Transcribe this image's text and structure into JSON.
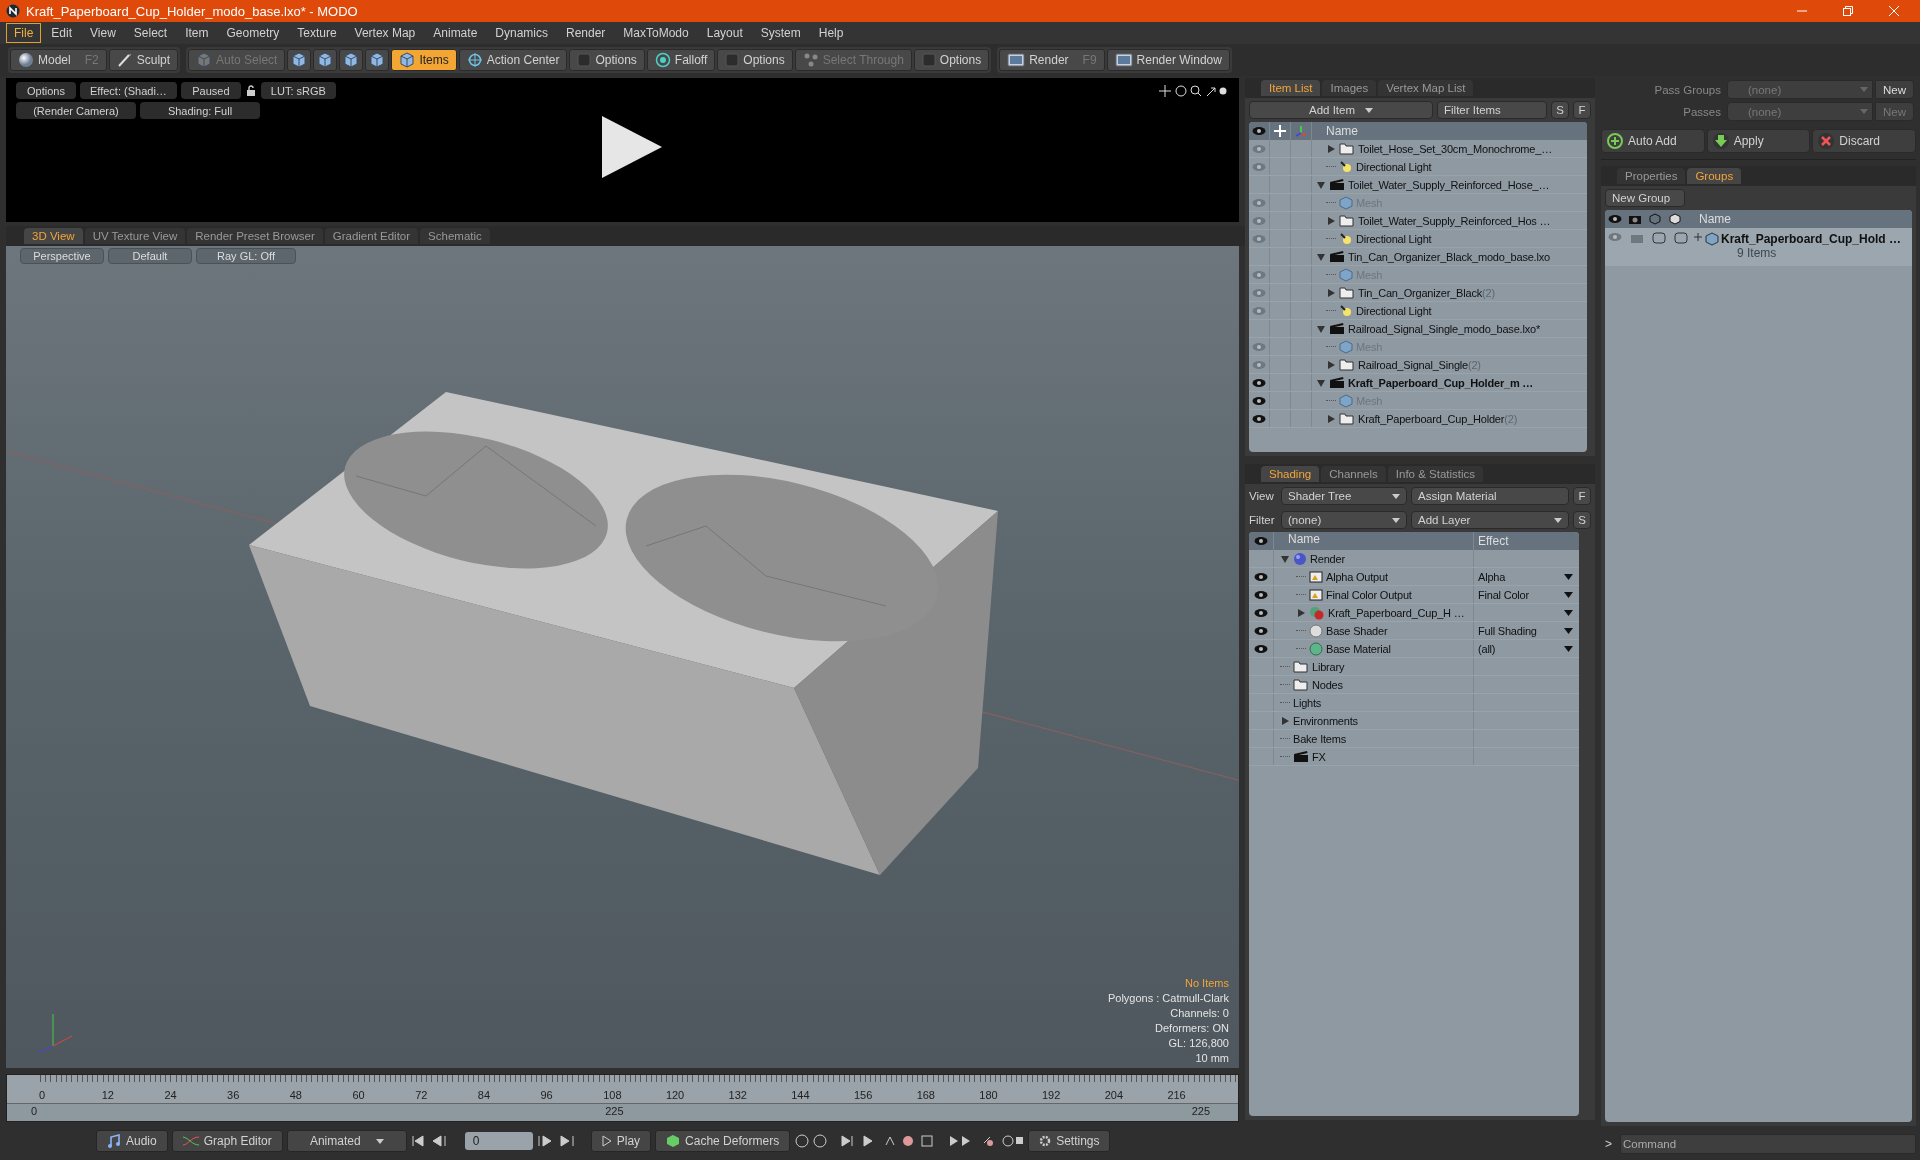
{
  "window": {
    "title": "Kraft_Paperboard_Cup_Holder_modo_base.lxo* - MODO"
  },
  "menu": [
    {
      "label": "File",
      "selected": true
    },
    {
      "label": "Edit",
      "selected": false
    },
    {
      "label": "View",
      "selected": false
    },
    {
      "label": "Select",
      "selected": false
    },
    {
      "label": "Item",
      "selected": false
    },
    {
      "label": "Geometry",
      "selected": false
    },
    {
      "label": "Texture",
      "selected": false
    },
    {
      "label": "Vertex Map",
      "selected": false
    },
    {
      "label": "Animate",
      "selected": false
    },
    {
      "label": "Dynamics",
      "selected": false
    },
    {
      "label": "Render",
      "selected": false
    },
    {
      "label": "MaxToModo",
      "selected": false
    },
    {
      "label": "Layout",
      "selected": false
    },
    {
      "label": "System",
      "selected": false
    },
    {
      "label": "Help",
      "selected": false
    }
  ],
  "toolbar": [
    [
      {
        "kind": "model",
        "label": "Model",
        "shortcut": "F2",
        "selected": false,
        "disabled": false
      },
      {
        "kind": "sculpt",
        "label": "Sculpt",
        "selected": false,
        "disabled": false
      }
    ],
    [
      {
        "kind": "autoselect",
        "label": "Auto Select",
        "selected": false,
        "disabled": true
      },
      {
        "kind": "vertex",
        "selected": false,
        "disabled": false
      },
      {
        "kind": "edge",
        "selected": false,
        "disabled": false
      },
      {
        "kind": "polygon",
        "selected": false,
        "disabled": false
      },
      {
        "kind": "material",
        "selected": false,
        "disabled": false
      },
      {
        "kind": "items",
        "label": "Items",
        "selected": true,
        "disabled": false
      },
      {
        "kind": "center",
        "label": "Action Center",
        "selected": false,
        "disabled": false
      },
      {
        "kind": "check",
        "label": "Options",
        "selected": false,
        "disabled": false
      },
      {
        "kind": "falloff",
        "label": "Falloff",
        "selected": false,
        "disabled": false
      },
      {
        "kind": "check",
        "label": "Options",
        "selected": false,
        "disabled": false
      },
      {
        "kind": "through",
        "label": "Select Through",
        "selected": false,
        "disabled": true
      },
      {
        "kind": "check",
        "label": "Options",
        "selected": false,
        "disabled": false
      }
    ],
    [
      {
        "kind": "render",
        "label": "Render",
        "shortcut": "F9",
        "selected": false,
        "disabled": false
      },
      {
        "kind": "window",
        "label": "Render Window",
        "selected": false,
        "disabled": false
      }
    ]
  ],
  "preview": {
    "buttons": [
      "Options",
      "Effect: (Shadi…",
      "Paused"
    ],
    "lut": "LUT: sRGB",
    "row2": [
      "(Render Camera)",
      "Shading: Full"
    ]
  },
  "viewport": {
    "tabs": [
      {
        "label": "3D View",
        "selected": true
      },
      {
        "label": "UV Texture View",
        "selected": false
      },
      {
        "label": "Render Preset Browser",
        "selected": false
      },
      {
        "label": "Gradient Editor",
        "selected": false
      },
      {
        "label": "Schematic",
        "selected": false
      }
    ],
    "header": [
      "Perspective",
      "Default",
      "Ray GL: Off"
    ],
    "selection": "No Items",
    "info": [
      "Polygons : Catmull-Clark",
      "Channels: 0",
      "Deformers: ON",
      "GL: 126,800",
      "10 mm"
    ]
  },
  "timeline": {
    "ticks": [
      "0",
      "12",
      "24",
      "36",
      "48",
      "60",
      "72",
      "84",
      "96",
      "108",
      "120",
      "132",
      "144",
      "156",
      "168",
      "180",
      "192",
      "204",
      "216"
    ],
    "start": "0",
    "middle": "225",
    "end": "225"
  },
  "transport": {
    "audio": "Audio",
    "graph": "Graph Editor",
    "mode": "Animated",
    "frame": "0",
    "play": "Play",
    "cache": "Cache Deformers",
    "settings": "Settings"
  },
  "item_list": {
    "tabs": [
      {
        "label": "Item List",
        "selected": true
      },
      {
        "label": "Images",
        "selected": false
      },
      {
        "label": "Vertex Map List",
        "selected": false
      }
    ],
    "add_item": "Add Item",
    "filter": "Filter Items",
    "toggles": [
      "S",
      "F"
    ],
    "column": "Name",
    "rows": [
      {
        "children": [
          {
            "label": "Toilet_Hose_Set_30cm_Monochrome_…",
            "kind": "group",
            "visible": false,
            "expanded": false
          },
          {
            "label": "Directional Light",
            "kind": "light",
            "visible": false
          }
        ]
      },
      {
        "label": "Toilet_Water_Supply_Reinforced_Hose_…",
        "kind": "scene",
        "current": false,
        "expanded": true,
        "children": [
          {
            "label": "Mesh",
            "kind": "mesh",
            "visible": false
          },
          {
            "label": "Toilet_Water_Supply_Reinforced_Hos …",
            "kind": "group",
            "visible": false,
            "expanded": false
          },
          {
            "label": "Directional Light",
            "kind": "light",
            "visible": false
          }
        ]
      },
      {
        "label": "Tin_Can_Organizer_Black_modo_base.lxo",
        "kind": "scene",
        "current": false,
        "expanded": true,
        "children": [
          {
            "label": "Mesh",
            "kind": "mesh",
            "visible": false
          },
          {
            "label": "Tin_Can_Organizer_Black",
            "count": "(2)",
            "kind": "group",
            "visible": false,
            "expanded": false
          },
          {
            "label": "Directional Light",
            "kind": "light",
            "visible": false
          }
        ]
      },
      {
        "label": "Railroad_Signal_Single_modo_base.lxo*",
        "kind": "scene",
        "current": false,
        "expanded": true,
        "children": [
          {
            "label": "Mesh",
            "kind": "mesh",
            "visible": false
          },
          {
            "label": "Railroad_Signal_Single",
            "count": "(2)",
            "kind": "group",
            "visible": false,
            "expanded": false
          }
        ]
      },
      {
        "label": "Kraft_Paperboard_Cup_Holder_m …",
        "kind": "scene",
        "current": true,
        "visible": true,
        "expanded": true,
        "children": [
          {
            "label": "Mesh",
            "kind": "mesh",
            "visible": true
          },
          {
            "label": "Kraft_Paperboard_Cup_Holder",
            "count": "(2)",
            "kind": "group",
            "visible": true,
            "expanded": false
          }
        ]
      }
    ]
  },
  "shading": {
    "tabs": [
      {
        "label": "Shading",
        "selected": true
      },
      {
        "label": "Channels",
        "selected": false
      },
      {
        "label": "Info & Statistics",
        "selected": false
      }
    ],
    "view_label": "View",
    "view": "Shader Tree",
    "assign": "Assign Material",
    "assign_key": "F",
    "filter_label": "Filter",
    "filter": "(none)",
    "add_layer": "Add Layer",
    "add_key": "S",
    "columns": [
      "Name",
      "Effect"
    ],
    "rows": [
      {
        "label": "Render",
        "kind": "render",
        "expanded": true,
        "children": [
          {
            "label": "Alpha Output",
            "kind": "output",
            "visible": true,
            "effect": "Alpha",
            "dropdown": true
          },
          {
            "label": "Final Color Output",
            "kind": "output",
            "visible": true,
            "effect": "Final Color",
            "dropdown": true
          },
          {
            "label": "Kraft_Paperboard_Cup_H …",
            "kind": "material",
            "visible": true,
            "expanded": false,
            "dropdown": true
          },
          {
            "label": "Base Shader",
            "kind": "shader",
            "visible": true,
            "effect": "Full Shading",
            "dropdown": true
          },
          {
            "label": "Base Material",
            "kind": "basematerial",
            "visible": true,
            "effect": "(all)",
            "dropdown": true
          }
        ]
      },
      {
        "label": "Library",
        "kind": "folder"
      },
      {
        "label": "Nodes",
        "kind": "folder"
      },
      {
        "label": "Lights",
        "kind": "plain"
      },
      {
        "label": "Environments",
        "kind": "plain",
        "expanded": false
      },
      {
        "label": "Bake Items",
        "kind": "plain"
      },
      {
        "label": "FX",
        "kind": "fx"
      }
    ]
  },
  "passes": {
    "rows": [
      {
        "label": "Pass Groups",
        "value": "(none)",
        "button": "New",
        "disabled": false
      },
      {
        "label": "Passes",
        "value": "(none)",
        "button": "New",
        "disabled": true
      }
    ],
    "actions": [
      {
        "kind": "add",
        "label": "Auto Add"
      },
      {
        "kind": "apply",
        "label": "Apply"
      },
      {
        "kind": "discard",
        "label": "Discard"
      }
    ]
  },
  "groups": {
    "tabs": [
      {
        "label": "Properties",
        "selected": false
      },
      {
        "label": "Groups",
        "selected": true
      }
    ],
    "new_group": "New Group",
    "column": "Name",
    "rows": [
      {
        "label": "Kraft_Paperboard_Cup_Hold …",
        "count": "9 Items"
      }
    ]
  },
  "command": {
    "prompt": ">",
    "placeholder": "Command"
  }
}
